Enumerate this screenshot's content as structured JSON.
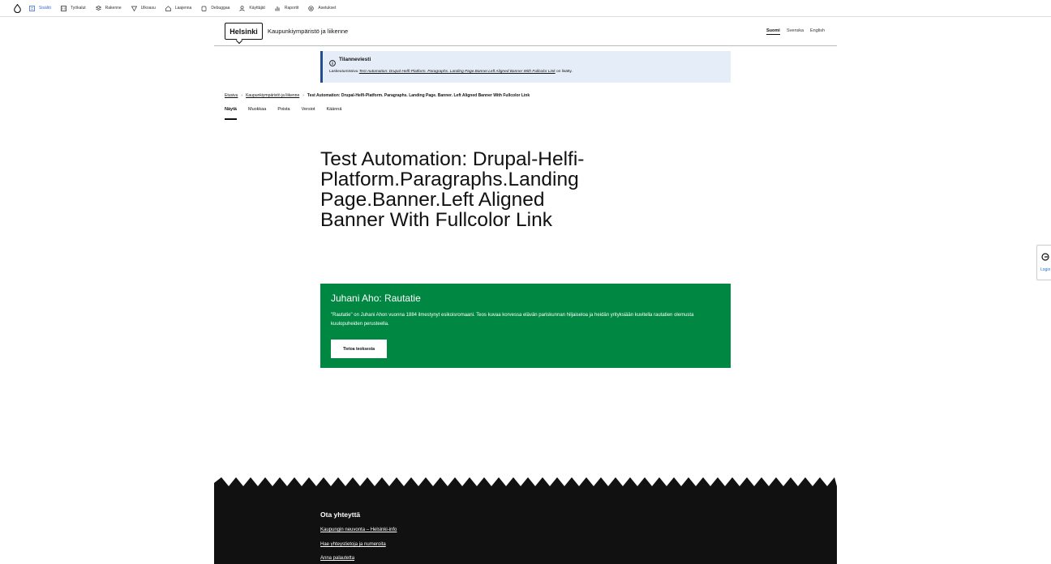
{
  "admin_toolbar": {
    "items": [
      {
        "label": "Sisältö",
        "icon": "content-icon",
        "active": true
      },
      {
        "label": "Työkalut",
        "icon": "tools-icon"
      },
      {
        "label": "Rakenne",
        "icon": "structure-icon"
      },
      {
        "label": "Ulkoasu",
        "icon": "appearance-icon"
      },
      {
        "label": "Laajenna",
        "icon": "extend-icon"
      },
      {
        "label": "Debuggaa",
        "icon": "debug-icon"
      },
      {
        "label": "Käyttäjät",
        "icon": "people-icon"
      },
      {
        "label": "Raportit",
        "icon": "reports-icon"
      },
      {
        "label": "Asetukset",
        "icon": "settings-icon"
      }
    ],
    "accent_color": "#3b6bd6"
  },
  "header": {
    "logo_text": "Helsinki",
    "site_name": "Kaupunkiympäristö ja liikenne",
    "languages": [
      {
        "label": "Suomi",
        "active": true
      },
      {
        "label": "Svenska"
      },
      {
        "label": "English"
      }
    ]
  },
  "status_message": {
    "title": "Tilanneviesti",
    "text_before": "Laskeutumissivu ",
    "link_text": "Test Automation: Drupal-Helfi-Platform. Paragraphs. Landing Page.Banner.Left Aligned Banner With Fullcolor Link",
    "text_after": " on lisätty."
  },
  "breadcrumb": {
    "items": [
      "Etusivu",
      "Kaupunkiympäristö ja liikenne"
    ],
    "current": "Test Automation: Drupal-Helfi-Platform. Paragraphs. Landing Page. Banner. Left Aligned Banner With Fullcolor Link"
  },
  "tabs": [
    "Näytä",
    "Muokkaa",
    "Poista",
    "Versiot",
    "Käännä"
  ],
  "page_title": "Test Automation: Drupal-Helfi-Platform.Paragraphs.Landing Page.Banner.Left Aligned Banner With Fullcolor Link",
  "banner": {
    "title": "Juhani Aho: Rautatie",
    "description": "\"Rautatie\" on Juhani Ahon vuonna 1884 ilmestynyt esikoisromaani. Teos kuvaa korvessa elävän pariskunnan hiljaiseloa ja heidän yrityksiään kuvitella rautatien olemusta kuulopuheiden perusteella.",
    "button_label": "Tietoa teoksesta",
    "color": "#008741"
  },
  "side_widget": {
    "label": "Login"
  },
  "footer": {
    "title": "Ota yhteyttä",
    "links": [
      "Kaupungin neuvonta – Helsinki-info",
      "Hae yhteystietoja ja numeroita",
      "Anna palautetta"
    ]
  }
}
